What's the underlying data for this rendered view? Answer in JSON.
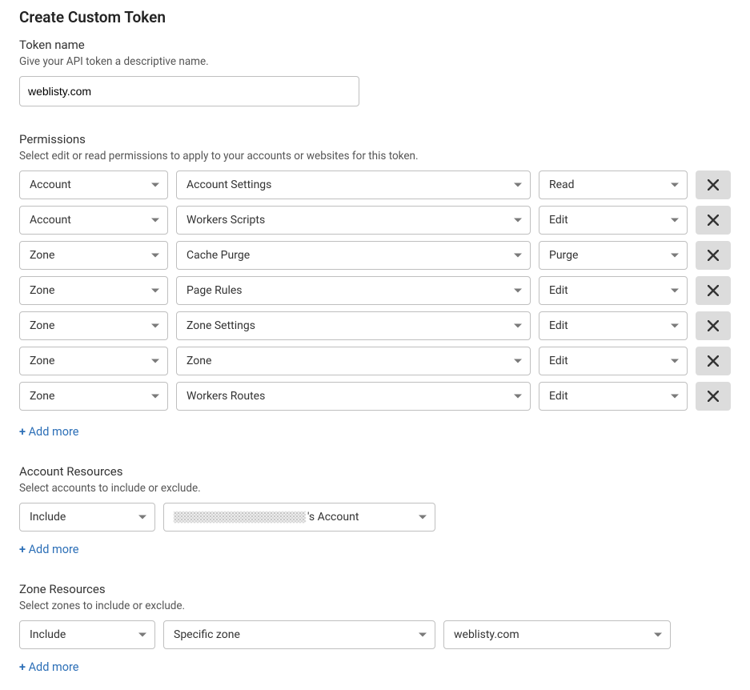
{
  "page_title": "Create Custom Token",
  "token_name_section": {
    "label": "Token name",
    "desc": "Give your API token a descriptive name.",
    "value": "weblisty.com"
  },
  "permissions_section": {
    "label": "Permissions",
    "desc": "Select edit or read permissions to apply to your accounts or websites for this token.",
    "rows": [
      {
        "scope": "Account",
        "resource": "Account Settings",
        "access": "Read"
      },
      {
        "scope": "Account",
        "resource": "Workers Scripts",
        "access": "Edit"
      },
      {
        "scope": "Zone",
        "resource": "Cache Purge",
        "access": "Purge"
      },
      {
        "scope": "Zone",
        "resource": "Page Rules",
        "access": "Edit"
      },
      {
        "scope": "Zone",
        "resource": "Zone Settings",
        "access": "Edit"
      },
      {
        "scope": "Zone",
        "resource": "Zone",
        "access": "Edit"
      },
      {
        "scope": "Zone",
        "resource": "Workers Routes",
        "access": "Edit"
      }
    ],
    "add_more": "Add more"
  },
  "account_resources_section": {
    "label": "Account Resources",
    "desc": "Select accounts to include or exclude.",
    "rows": [
      {
        "mode": "Include",
        "account_suffix": "'s Account"
      }
    ],
    "add_more": "Add more"
  },
  "zone_resources_section": {
    "label": "Zone Resources",
    "desc": "Select zones to include or exclude.",
    "rows": [
      {
        "mode": "Include",
        "scope": "Specific zone",
        "zone": "weblisty.com"
      }
    ],
    "add_more": "Add more"
  }
}
